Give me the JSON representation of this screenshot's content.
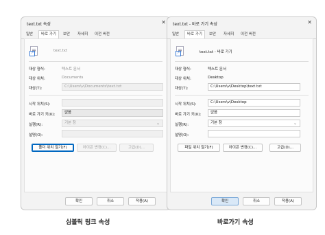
{
  "left": {
    "title": "text.txt 속성",
    "close": "✕",
    "tabs": [
      "일반",
      "바로 가기",
      "보안",
      "자세히",
      "이전 버전"
    ],
    "file_name": "text.txt",
    "type_label": "대상 형식:",
    "type_value": "텍스트 문서",
    "location_label": "대상 위치:",
    "location_value": "Documents",
    "target_label": "대상(T):",
    "target_value": "C:\\Users\\v\\Documents\\text.txt",
    "start_label": "시작 위치(S):",
    "start_value": "",
    "hotkey_label": "바로 가기 키(K):",
    "hotkey_value": "없음",
    "run_label": "실행(R):",
    "run_value": "기본 창",
    "comment_label": "설명(O):",
    "comment_value": "",
    "open_location_btn": "폴더 위치 열기(F)",
    "change_icon_btn": "아이콘 변경(C)...",
    "advanced_btn": "고급(D)...",
    "ok_btn": "확인",
    "cancel_btn": "취소",
    "apply_btn": "적용(A)"
  },
  "right": {
    "title": "text.txt - 바로 가기 속성",
    "close": "✕",
    "tabs": [
      "일반",
      "바로 가기",
      "보안",
      "자세히",
      "이전 버전"
    ],
    "file_name": "text.txt - 바로 가기",
    "type_label": "대상 형식:",
    "type_value": "텍스트 문서",
    "location_label": "대상 위치:",
    "location_value": "Desktop",
    "target_label": "대상(T):",
    "target_value": "C:\\Users\\v\\Desktop\\text.txt",
    "start_label": "시작 위치(S):",
    "start_value": "C:\\Users\\v\\Desktop",
    "hotkey_label": "바로 가기 키(K):",
    "hotkey_value": "없음",
    "run_label": "실행(R):",
    "run_value": "기본 창",
    "comment_label": "설명(O):",
    "comment_value": "",
    "open_location_btn": "파일 위치 열기(F)",
    "change_icon_btn": "아이콘 변경(C)...",
    "advanced_btn": "고급(D)...",
    "ok_btn": "확인",
    "cancel_btn": "취소",
    "apply_btn": "적용(A)"
  },
  "captions": {
    "left": "심볼릭 링크 속성",
    "right": "바로가기 속성"
  },
  "colors": {
    "accent": "#0067c0",
    "window_bg": "#f3f3f3"
  }
}
